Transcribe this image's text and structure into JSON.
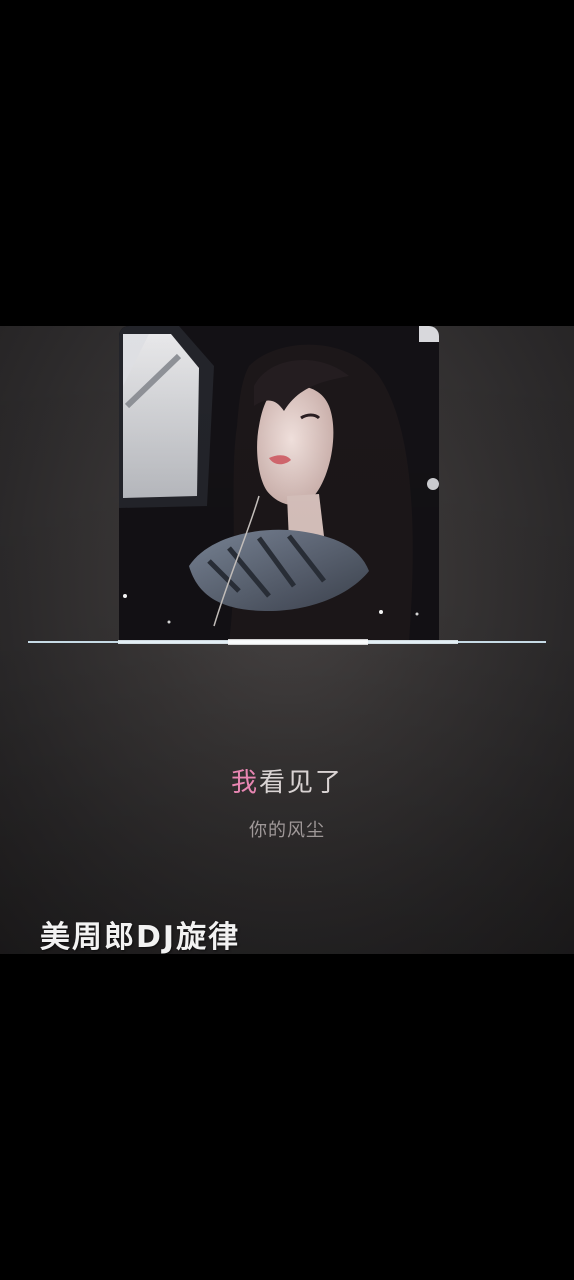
{
  "lyrics": {
    "current_line_highlight": "我",
    "current_line_rest": "看见了",
    "next_line": "你的风尘"
  },
  "watermark": {
    "text": "美周郎DJ旋律"
  },
  "colors": {
    "background": "#000000",
    "panel": "#3a3737",
    "lyric_highlight": "#e886b2",
    "lyric_text": "#d9d3d3",
    "lyric_sub": "#9f9898",
    "watermark": "#f2f2f2"
  },
  "cover": {
    "depicts": "album-art-photo"
  }
}
